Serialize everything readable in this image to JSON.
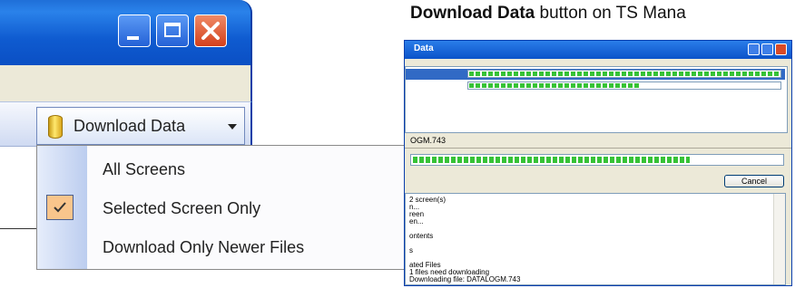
{
  "caption": {
    "bold": "Download Data",
    "rest": " button on TS Mana"
  },
  "zoom_window": {
    "toolbar": {
      "button_label": "Download Data",
      "icon": "database-icon",
      "dropdown_icon": "chevron-down-icon"
    },
    "menu": {
      "items": [
        {
          "label": "All Screens",
          "checked": false
        },
        {
          "label": "Selected Screen Only",
          "checked": true
        },
        {
          "label": "Download Only Newer Files",
          "checked": false
        }
      ]
    },
    "title_buttons": [
      "minimize-icon",
      "maximize-icon",
      "close-icon"
    ]
  },
  "dialog": {
    "title": "Data",
    "list_progress": [
      1.0,
      0.55
    ],
    "current_file": "OGM.743",
    "file_progress": 0.75,
    "cancel_label": "Cancel",
    "log_lines": [
      "2 screen(s)",
      "n...",
      "reen",
      "en...",
      "",
      "ontents",
      "",
      "s",
      "",
      "ated Files",
      "1 files need downloading",
      "Downloading file: DATALOGM.743"
    ]
  },
  "colors": {
    "xp_title_blue": "#0f5bd0",
    "menu_check_highlight": "#f9c58c",
    "progress_green": "#36c236"
  }
}
